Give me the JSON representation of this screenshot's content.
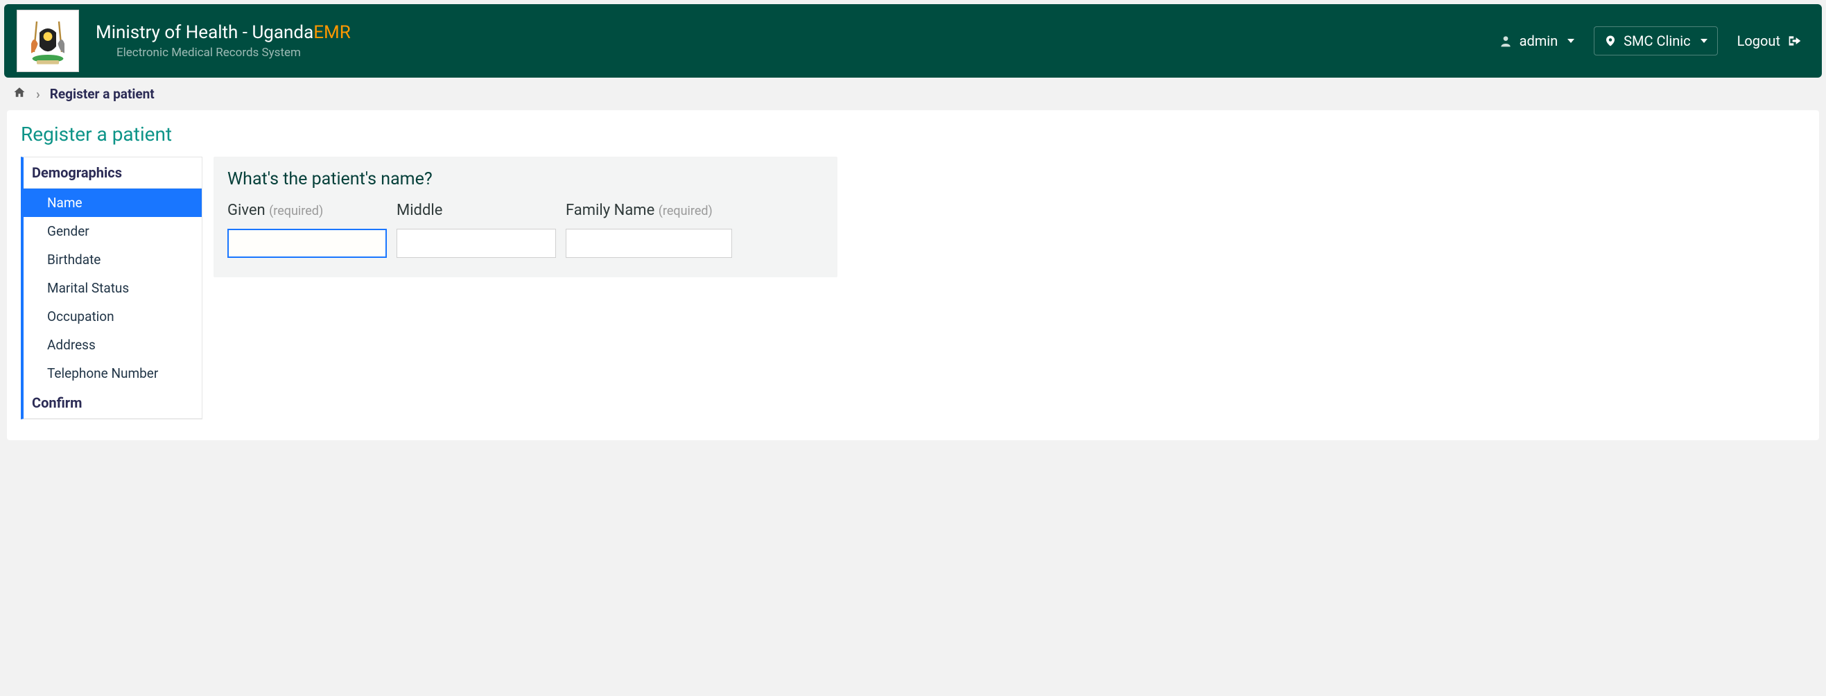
{
  "header": {
    "title_prefix": "Ministry of Health - Uganda",
    "title_suffix": "EMR",
    "subtitle": "Electronic Medical Records System",
    "user": "admin",
    "location": "SMC Clinic",
    "logout": "Logout"
  },
  "breadcrumb": {
    "current": "Register a patient"
  },
  "page": {
    "title": "Register a patient"
  },
  "sidebar": {
    "section": "Demographics",
    "items": [
      {
        "label": "Name",
        "active": true
      },
      {
        "label": "Gender",
        "active": false
      },
      {
        "label": "Birthdate",
        "active": false
      },
      {
        "label": "Marital Status",
        "active": false
      },
      {
        "label": "Occupation",
        "active": false
      },
      {
        "label": "Address",
        "active": false
      },
      {
        "label": "Telephone Number",
        "active": false
      }
    ],
    "confirm": "Confirm"
  },
  "form": {
    "question": "What's the patient's name?",
    "required": "(required)",
    "fields": {
      "given": {
        "label": "Given",
        "value": "",
        "required": true
      },
      "middle": {
        "label": "Middle",
        "value": "",
        "required": false
      },
      "family": {
        "label": "Family Name",
        "value": "",
        "required": true
      }
    }
  }
}
